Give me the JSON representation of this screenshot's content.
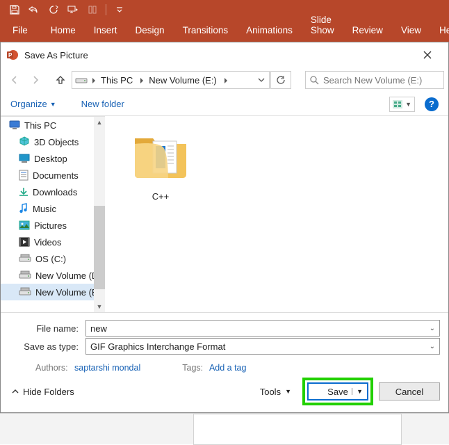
{
  "ribbon": {
    "tabs": [
      "File",
      "Home",
      "Insert",
      "Design",
      "Transitions",
      "Animations",
      "Slide Show",
      "Review",
      "View",
      "Help"
    ]
  },
  "dialog": {
    "title": "Save As Picture",
    "breadcrumb": {
      "root": "This PC",
      "current": "New Volume (E:)"
    },
    "search_placeholder": "Search New Volume (E:)",
    "toolbar": {
      "organize": "Organize",
      "newfolder": "New folder"
    },
    "tree": [
      {
        "label": "This PC",
        "indent": 0,
        "icon": "pc"
      },
      {
        "label": "3D Objects",
        "indent": 1,
        "icon": "3d"
      },
      {
        "label": "Desktop",
        "indent": 1,
        "icon": "desktop"
      },
      {
        "label": "Documents",
        "indent": 1,
        "icon": "docs"
      },
      {
        "label": "Downloads",
        "indent": 1,
        "icon": "downloads"
      },
      {
        "label": "Music",
        "indent": 1,
        "icon": "music"
      },
      {
        "label": "Pictures",
        "indent": 1,
        "icon": "pictures"
      },
      {
        "label": "Videos",
        "indent": 1,
        "icon": "videos"
      },
      {
        "label": "OS (C:)",
        "indent": 1,
        "icon": "drive"
      },
      {
        "label": "New Volume (D:)",
        "indent": 1,
        "icon": "drive"
      },
      {
        "label": "New Volume (E:)",
        "indent": 1,
        "icon": "drive",
        "selected": true
      }
    ],
    "content_folder": "C++",
    "filename_label": "File name:",
    "filename_value": "new",
    "type_label": "Save as type:",
    "type_value": "GIF Graphics Interchange Format",
    "authors_label": "Authors:",
    "authors_value": "saptarshi mondal",
    "tags_label": "Tags:",
    "tags_value": "Add a tag",
    "hide_folders": "Hide Folders",
    "tools": "Tools",
    "save": "Save",
    "cancel": "Cancel"
  }
}
